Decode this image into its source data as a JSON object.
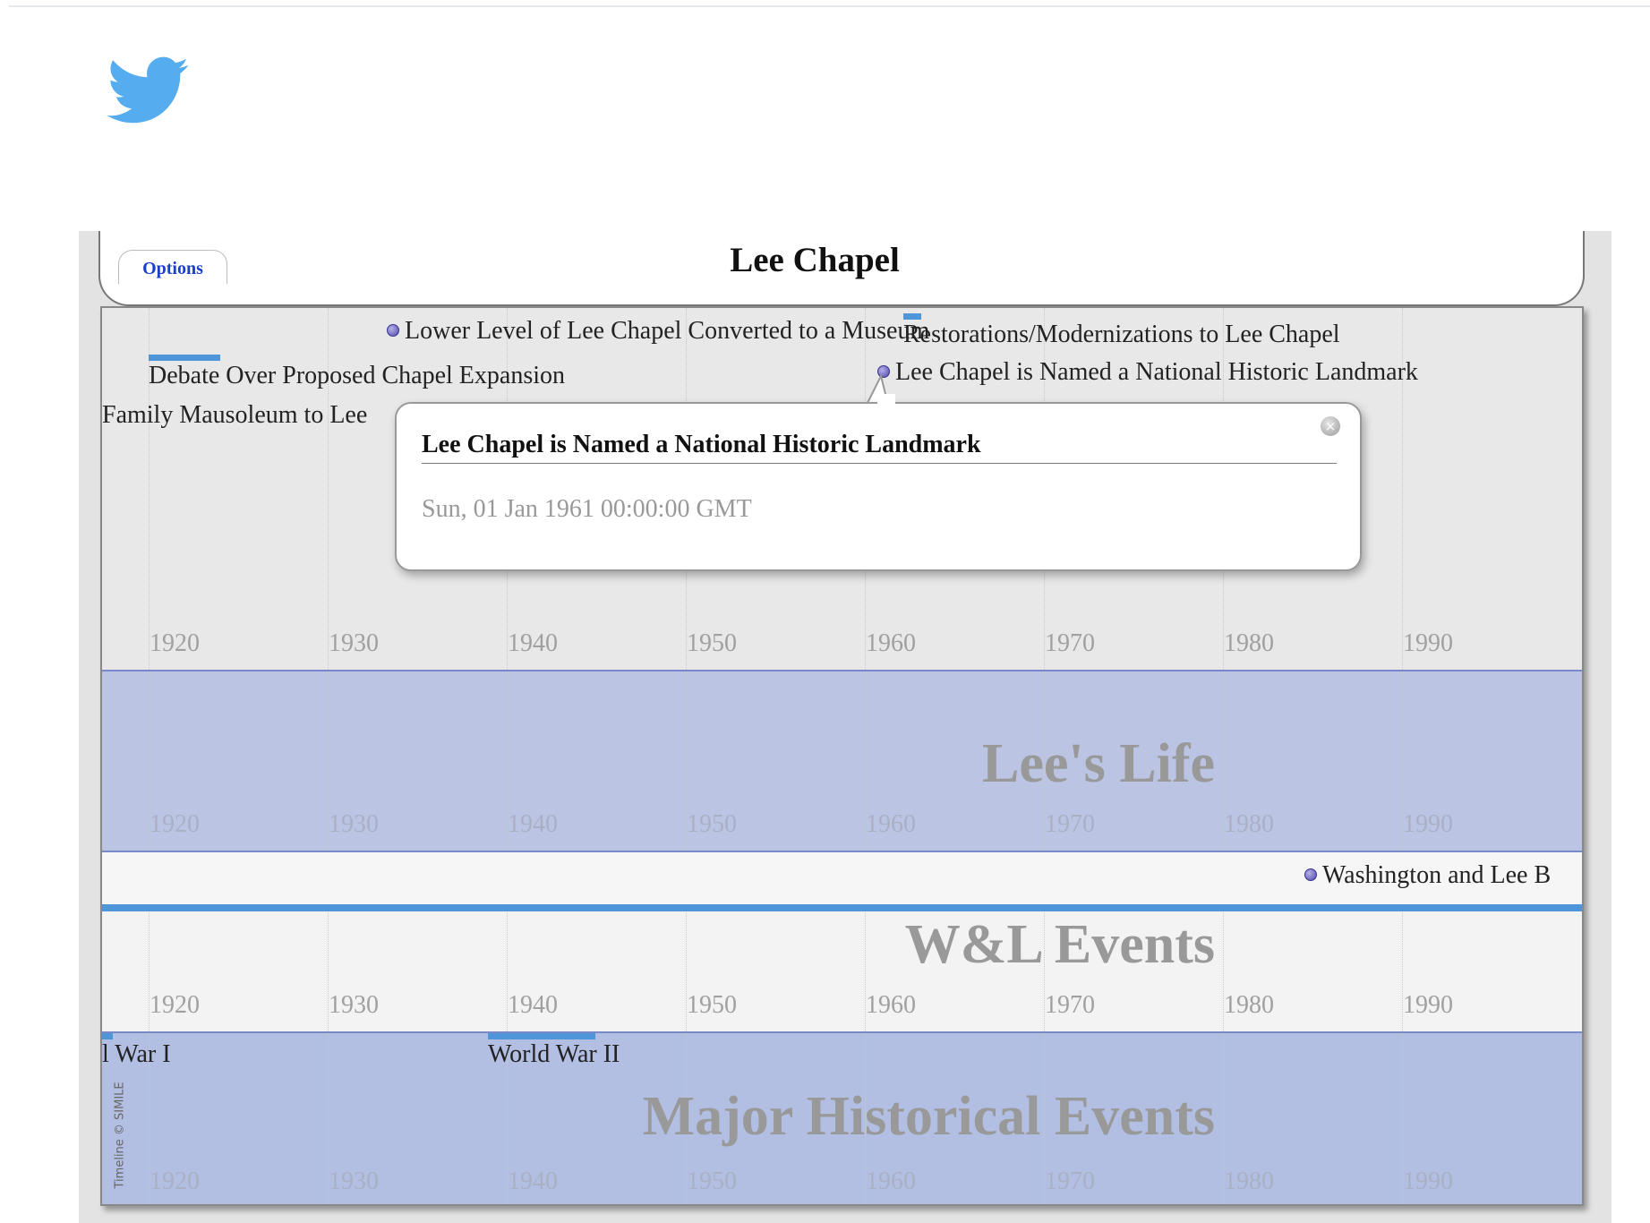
{
  "brand": {
    "icon": "twitter-bird-icon",
    "color": "#55acee"
  },
  "timeline": {
    "title": "Lee Chapel",
    "options_label": "Options",
    "credit": "Timeline © SIMILE",
    "years": [
      "1920",
      "1930",
      "1940",
      "1950",
      "1960",
      "1970",
      "1980",
      "1990"
    ],
    "bands": {
      "lees_life": {
        "label": "Lee's Life"
      },
      "wl_events": {
        "label": "W&L Events"
      },
      "historical": {
        "label": "Major Historical Events"
      }
    },
    "events": {
      "museum": "Lower Level of Lee Chapel Converted to a Museum",
      "restorations": "Restorations/Modernizations to Lee Chapel",
      "debate": "Debate Over Proposed Chapel Expansion",
      "landmark": "Lee Chapel is Named a National Historic Landmark",
      "mausoleum": "Family Mausoleum to Lee",
      "washington_lee": "Washington and Lee B",
      "ww1": "l War I",
      "ww2": "World War II"
    },
    "popup": {
      "title": "Lee Chapel is Named a National Historic Landmark",
      "date": "Sun, 01 Jan 1961 00:00:00 GMT"
    },
    "colors": {
      "duration": "#4f95d9",
      "band_blue": "#bcc4e4",
      "band_historical": "#b2bfe3",
      "options_link": "#1a3fc8"
    }
  }
}
